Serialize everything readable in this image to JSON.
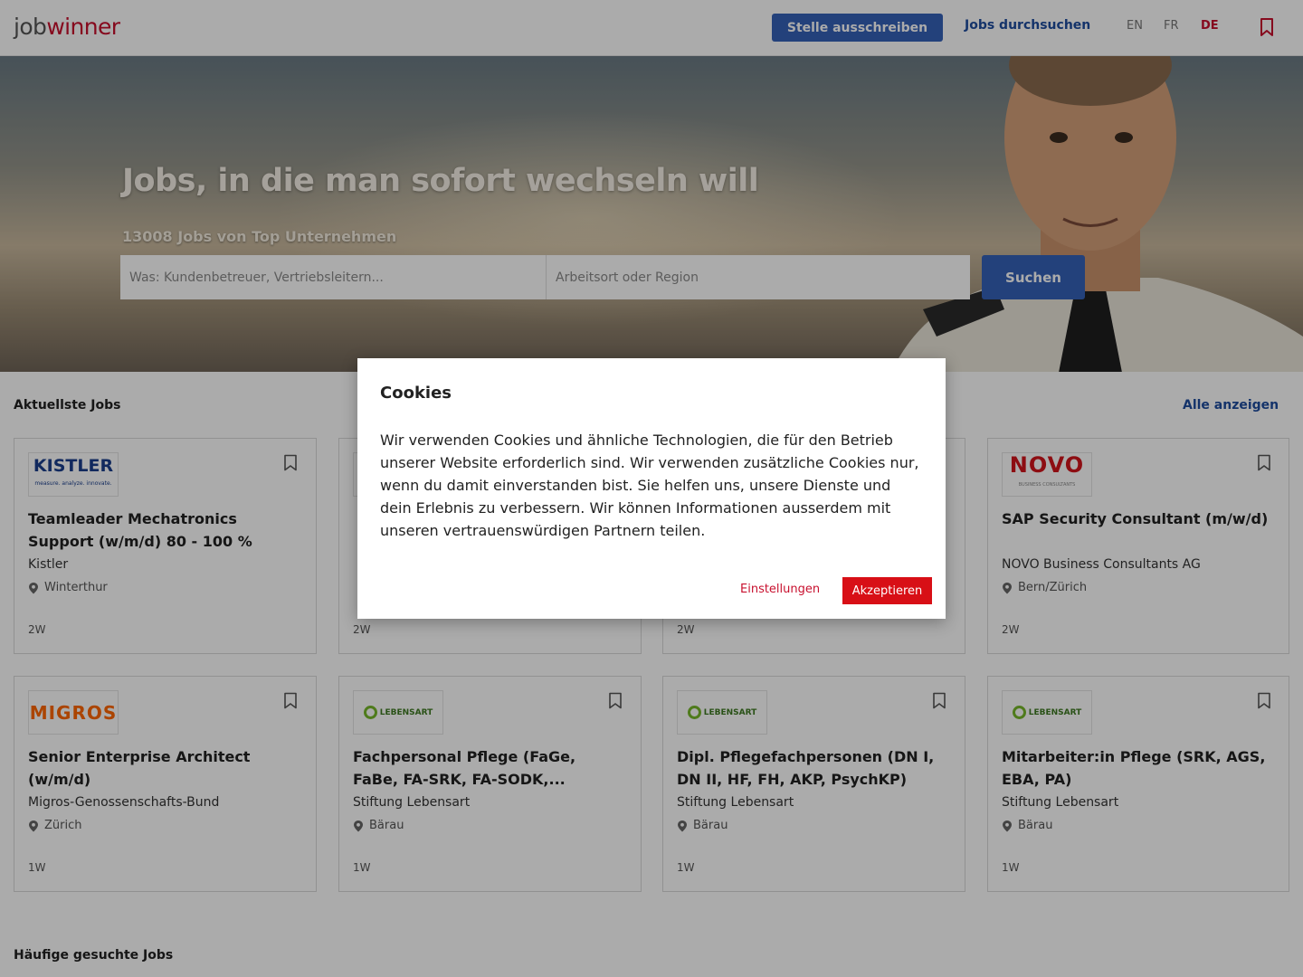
{
  "header": {
    "logo_part1": "job",
    "logo_part2": "winner",
    "post_job_label": "Stelle ausschreiben",
    "browse_jobs_label": "Jobs durchsuchen",
    "languages": [
      "EN",
      "FR",
      "DE"
    ],
    "active_language": "DE",
    "bookmark_icon": "bookmark-icon"
  },
  "hero": {
    "title": "Jobs, in die man sofort wechseln will",
    "subtitle": "13008 Jobs von Top Unternehmen",
    "what_placeholder": "Was: Kundenbetreuer, Vertriebsleitern...",
    "where_placeholder": "Arbeitsort oder Region",
    "search_label": "Suchen"
  },
  "latest": {
    "title": "Aktuellste Jobs",
    "show_all": "Alle anzeigen",
    "jobs": [
      {
        "logo": "KISTLER",
        "logo_tagline": "measure. analyze. innovate.",
        "title": "Teamleader Mechatronics Support (w/m/d) 80 - 100 %",
        "company": "Kistler",
        "location": "Winterthur",
        "age": "2W"
      },
      {
        "logo": "",
        "title": "",
        "company": "",
        "location": "",
        "age": "2W"
      },
      {
        "logo": "",
        "title": "",
        "company": "",
        "location": "",
        "age": "2W"
      },
      {
        "logo": "NOVO",
        "logo_tagline": "BUSINESS CONSULTANTS",
        "title": "SAP Security Consultant (m/w/d)",
        "company": "NOVO Business Consultants AG",
        "location": "Bern/Zürich",
        "age": "2W"
      },
      {
        "logo": "MIGROS",
        "title": "Senior Enterprise Architect (w/m/d)",
        "company": "Migros-Genossenschafts-Bund",
        "location": "Zürich",
        "age": "1W"
      },
      {
        "logo": "LEBENSART",
        "title": "Fachpersonal Pflege (FaGe, FaBe, FA-SRK, FA-SODK,...",
        "company": "Stiftung Lebensart",
        "location": "Bärau",
        "age": "1W"
      },
      {
        "logo": "LEBENSART",
        "title": "Dipl. Pflegefachpersonen (DN I, DN II, HF, FH, AKP, PsychKP)",
        "company": "Stiftung Lebensart",
        "location": "Bärau",
        "age": "1W"
      },
      {
        "logo": "LEBENSART",
        "title": "Mitarbeiter:in Pflege (SRK, AGS, EBA, PA)",
        "company": "Stiftung Lebensart",
        "location": "Bärau",
        "age": "1W"
      }
    ]
  },
  "popular": {
    "title": "Häufige gesuchte Jobs"
  },
  "cookie_modal": {
    "title": "Cookies",
    "text": "Wir verwenden Cookies und ähnliche Technologien, die für den Betrieb unserer Website erforderlich sind. Wir verwenden zusätzliche Cookies nur, wenn du damit einverstanden bist. Sie helfen uns, unsere Dienste und dein Erlebnis zu verbessern. Wir können Informationen ausserdem mit unseren vertrauenswürdigen Partnern teilen.",
    "settings_label": "Einstellungen",
    "accept_label": "Akzeptieren"
  },
  "colors": {
    "brand_blue": "#3561b8",
    "brand_red": "#c8102e",
    "accept_red": "#d80f16"
  }
}
